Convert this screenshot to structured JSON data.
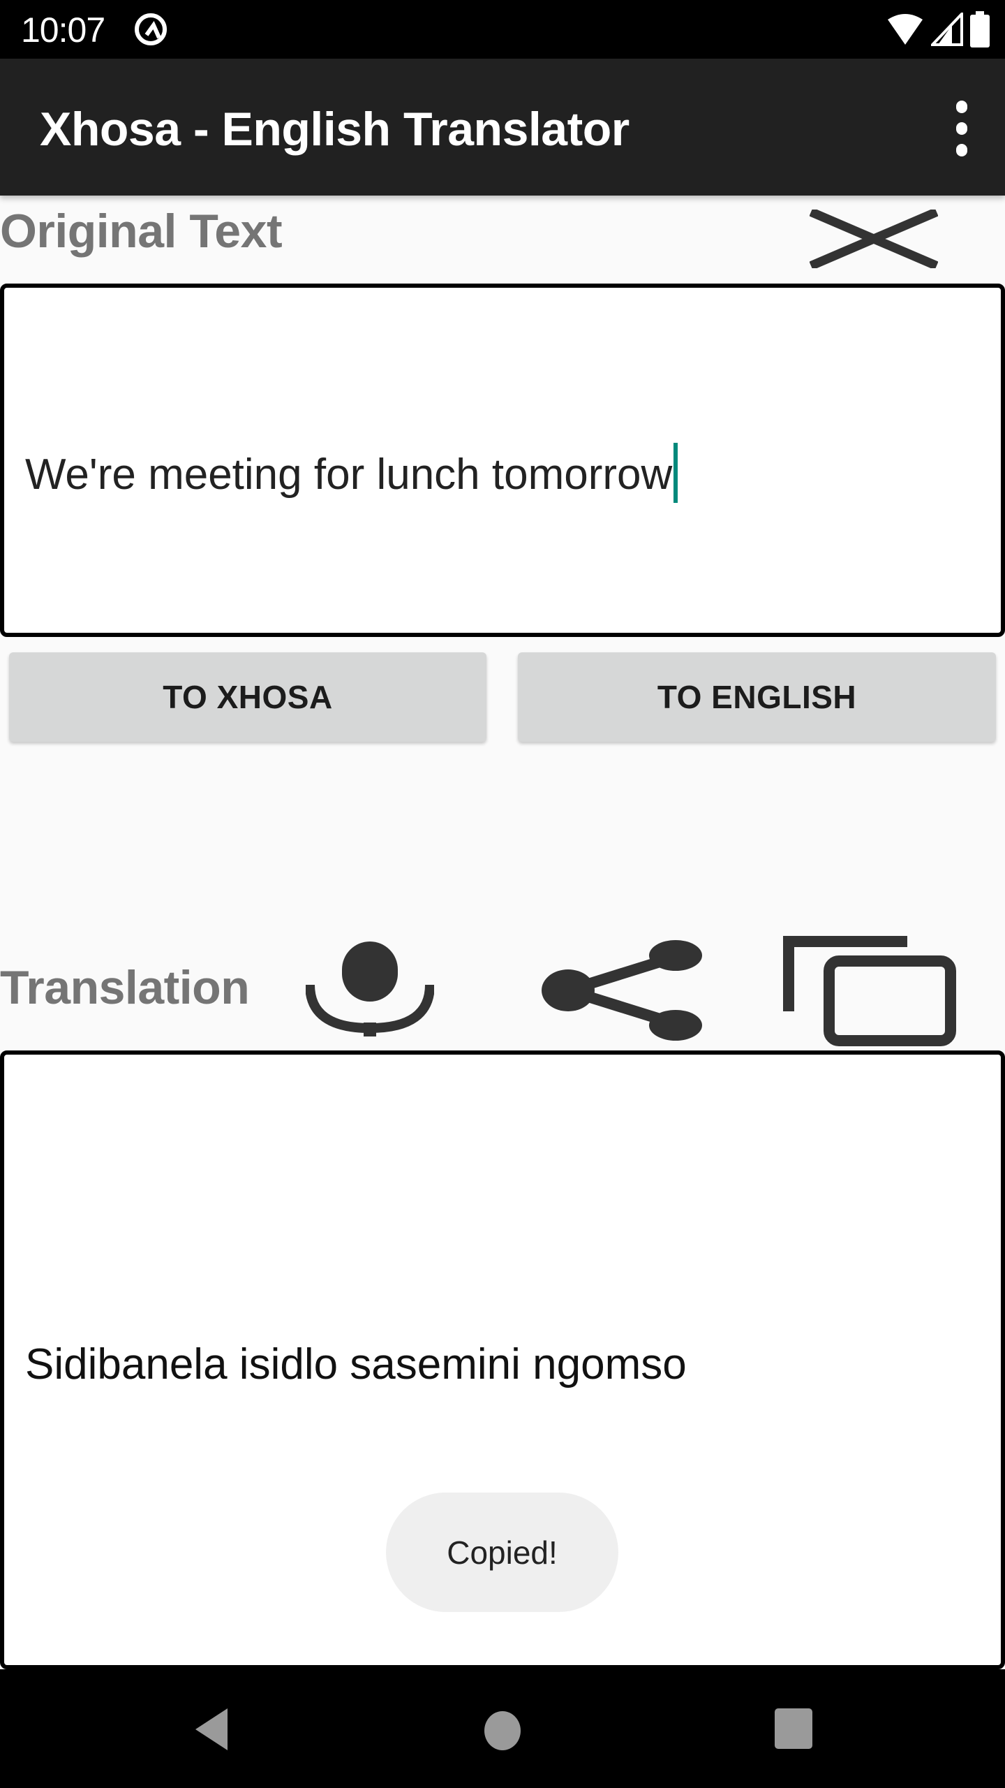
{
  "status_bar": {
    "time": "10:07",
    "icons": [
      "at-sign-icon",
      "wifi-icon",
      "cell-signal-icon",
      "battery-icon"
    ]
  },
  "app_bar": {
    "title": "Xhosa - English Translator",
    "overflow_icon": "more-vert-icon"
  },
  "original": {
    "label": "Original Text",
    "clear_icon": "close-icon",
    "input_value": "We're meeting for lunch tomorrow",
    "cursor_color": "#00897b"
  },
  "actions": {
    "to_xhosa": "TO XHOSA",
    "to_english": "TO ENGLISH"
  },
  "translation": {
    "label": "Translation",
    "icons": [
      "microphone-icon",
      "share-icon",
      "copy-icon"
    ],
    "output_value": "Sidibanela isidlo sasemini ngomso"
  },
  "toast": {
    "message": "Copied!"
  },
  "nav_bar": {
    "buttons": [
      "back-icon",
      "home-icon",
      "recents-icon"
    ]
  }
}
